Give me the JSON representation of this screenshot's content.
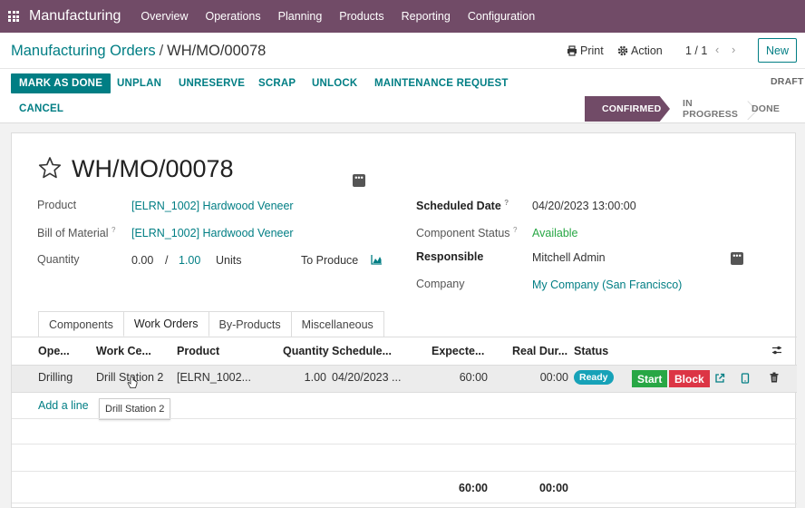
{
  "navbar": {
    "app_name": "Manufacturing",
    "menu": [
      "Overview",
      "Operations",
      "Planning",
      "Products",
      "Reporting",
      "Configuration"
    ]
  },
  "control_panel": {
    "breadcrumb_parent": "Manufacturing Orders",
    "breadcrumb_separator": "/",
    "breadcrumb_current": "WH/MO/00078",
    "print_label": "Print",
    "action_label": "Action",
    "pager": "1 / 1",
    "new_label": "New"
  },
  "header_buttons": {
    "mark_done": "MARK AS DONE",
    "unplan": "UNPLAN",
    "unreserve": "UNRESERVE",
    "scrap": "SCRAP",
    "unlock": "UNLOCK",
    "maintenance": "MAINTENANCE REQUEST",
    "cancel": "CANCEL"
  },
  "status": {
    "draft": "DRAFT",
    "confirmed": "CONFIRMED",
    "in_progress": "IN PROGRESS",
    "done": "DONE",
    "active_color": "#714b67"
  },
  "form": {
    "title": "WH/MO/00078",
    "product_label": "Product",
    "product_value": "[ELRN_1002] Hardwood Veneer",
    "bom_label": "Bill of Material",
    "bom_value": "[ELRN_1002] Hardwood Veneer",
    "quantity_label": "Quantity",
    "quantity_done": "0.00",
    "quantity_sep": "/",
    "quantity_total": "1.00",
    "quantity_uom": "Units",
    "to_produce_label": "To Produce",
    "scheduled_label": "Scheduled Date",
    "scheduled_value": "04/20/2023 13:00:00",
    "component_status_label": "Component Status",
    "component_status_value": "Available",
    "responsible_label": "Responsible",
    "responsible_value": "Mitchell Admin",
    "company_label": "Company",
    "company_value": "My Company (San Francisco)",
    "help_mark": "?"
  },
  "tabs": [
    "Components",
    "Work Orders",
    "By-Products",
    "Miscellaneous"
  ],
  "table": {
    "headers": [
      "Ope...",
      "Work Ce...",
      "Product",
      "Quantity",
      "Schedule...",
      "Expecte...",
      "Real Dur...",
      "Status"
    ],
    "row": {
      "operation": "Drilling",
      "work_center": "Drill Station 2",
      "product": "[ELRN_1002...",
      "quantity": "1.00",
      "scheduled": "04/20/2023 ...",
      "expected": "60:00",
      "real": "00:00",
      "status": "Ready",
      "start": "Start",
      "block": "Block"
    },
    "add_line": "Add a line",
    "tooltip": "Drill Station 2",
    "total_expected": "60:00",
    "total_real": "00:00"
  },
  "colors": {
    "brand": "#714b67",
    "primary": "#017e84",
    "success": "#28a745",
    "danger": "#dc3545",
    "info": "#17a2b8"
  }
}
